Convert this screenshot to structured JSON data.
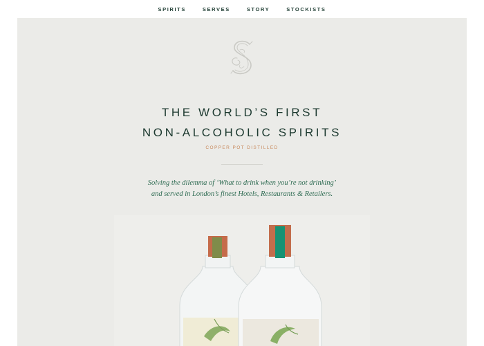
{
  "nav": {
    "items": [
      {
        "label": "SPIRITS"
      },
      {
        "label": "SERVES"
      },
      {
        "label": "STORY"
      },
      {
        "label": "STOCKISTS"
      }
    ]
  },
  "hero": {
    "logo_icon": "ornate-s-monogram-icon",
    "headline_line1": "THE WORLD’S FIRST",
    "headline_line2": "NON-ALCOHOLIC SPIRITS",
    "tagline": "COPPER POT DISTILLED",
    "description_line1": "Solving the dilemma of ‘What to drink when you’re not drinking’",
    "description_line2": "and served in London’s finest Hotels, Restaurants & Retailers."
  },
  "colors": {
    "brand_green": "#1d3a30",
    "accent_copper": "#c88a5e",
    "hero_background": "#ebebe8",
    "text_green": "#2e6b52"
  }
}
